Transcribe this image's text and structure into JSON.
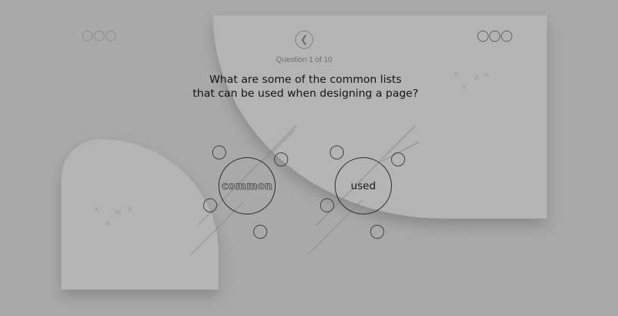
{
  "header": {
    "back_icon": "chevron-left-icon",
    "question_counter": "Question 1 of 10"
  },
  "question": {
    "line1": "What are some of the common lists",
    "line2": "that can be used when designing a page?"
  },
  "answers": [
    {
      "label": "common"
    },
    {
      "label": "used"
    }
  ],
  "colors": {
    "background": "#a9a9a9",
    "card": "#b4b4b4",
    "text": "#141414"
  }
}
